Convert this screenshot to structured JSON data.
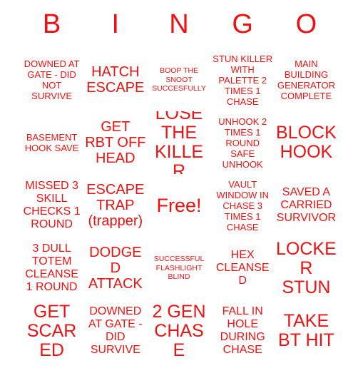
{
  "card": {
    "title": "BINGO",
    "accent_color": "#ee1111",
    "background_color": "#ffffff",
    "header_letters": [
      "B",
      "I",
      "N",
      "G",
      "O"
    ],
    "grid_size": "5x5",
    "free_space_label": "Free!",
    "free_space_position": "row 3, column 3",
    "rows": [
      [
        {
          "text": "DOWNED AT GATE - DID NOT SURVIVE",
          "size": "sm",
          "free": false
        },
        {
          "text": "HATCH ESCAPE",
          "size": "lg",
          "free": false
        },
        {
          "text": "BOOP THE SNOOT SUCCESFULLY",
          "size": "xs",
          "free": false
        },
        {
          "text": "STUN KILLER WITH PALETTE 2 TIMES 1 CHASE",
          "size": "sm",
          "free": false
        },
        {
          "text": "MAIN BUILDING GENERATOR COMPLETE",
          "size": "sm",
          "free": false
        }
      ],
      [
        {
          "text": "BASEMENT HOOK SAVE",
          "size": "sm",
          "free": false
        },
        {
          "text": "GET RBT OFF HEAD",
          "size": "lg",
          "free": false
        },
        {
          "text": "LOSE THE KILLER",
          "size": "xl",
          "free": false
        },
        {
          "text": "UNHOOK 2 TIMES 1 ROUND SAFE UNHOOK",
          "size": "sm",
          "free": false
        },
        {
          "text": "BLOCK HOOK",
          "size": "xl",
          "free": false
        }
      ],
      [
        {
          "text": "MISSED 3 SKILL CHECKS 1 ROUND",
          "size": "md",
          "free": false
        },
        {
          "text": "ESCAPE TRAP (trapper)",
          "size": "lg",
          "free": false
        },
        {
          "text": "Free!",
          "size": "xl",
          "free": true
        },
        {
          "text": "VAULT WINDOW IN CHASE 3 TIMES 1 CHASE",
          "size": "sm",
          "free": false
        },
        {
          "text": "SAVED A CARRIED SURVIVOR",
          "size": "md",
          "free": false
        }
      ],
      [
        {
          "text": "3 DULL TOTEM CLEANSE 1 ROUND",
          "size": "md",
          "free": false
        },
        {
          "text": "DODGED ATTACK",
          "size": "lg",
          "free": false
        },
        {
          "text": "SUCCESSFUL FLASHLIGHT BLIND",
          "size": "xs",
          "free": false
        },
        {
          "text": "HEX CLEANSED",
          "size": "md",
          "free": false
        },
        {
          "text": "LOCKER STUN",
          "size": "xl",
          "free": false
        }
      ],
      [
        {
          "text": "GET SCARED",
          "size": "xl",
          "free": false
        },
        {
          "text": "DOWNED AT GATE - DID SURVIVE",
          "size": "md",
          "free": false
        },
        {
          "text": "2 GEN CHASE",
          "size": "xl",
          "free": false
        },
        {
          "text": "FALL IN HOLE DURING CHASE",
          "size": "md",
          "free": false
        },
        {
          "text": "TAKE BT HIT",
          "size": "xl",
          "free": false
        }
      ]
    ]
  }
}
